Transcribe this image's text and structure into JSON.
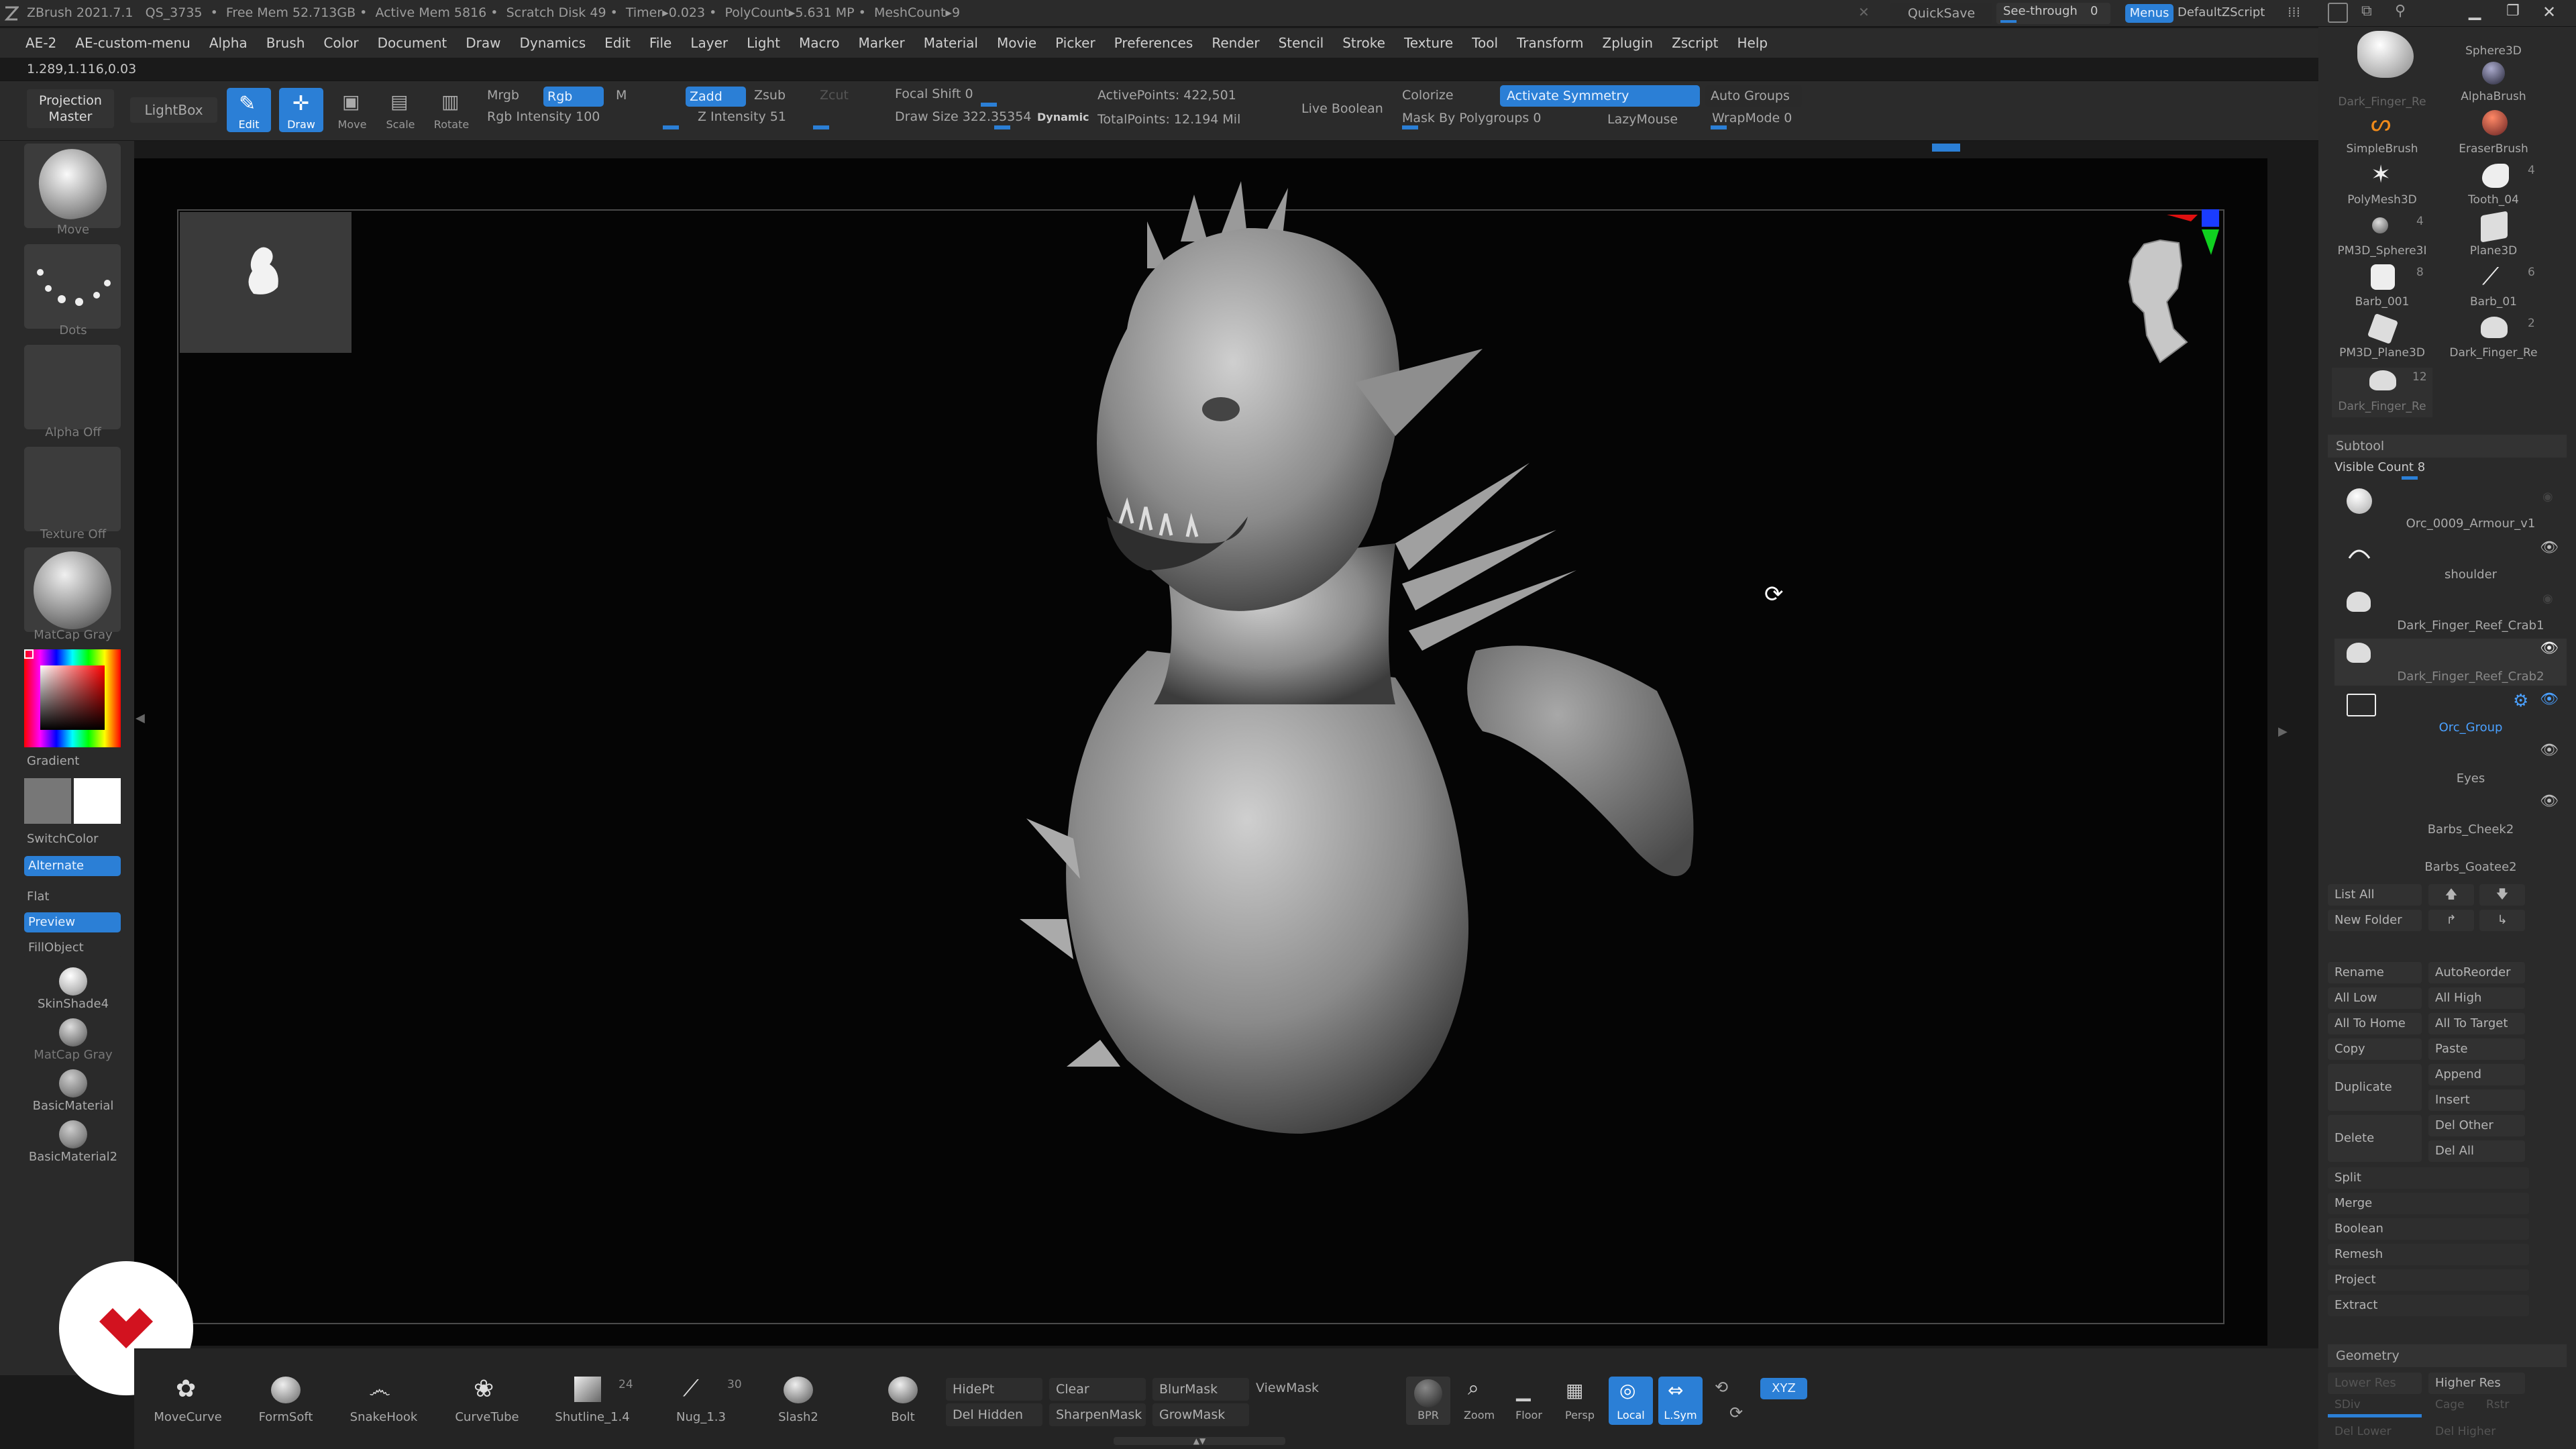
{
  "status_bar": {
    "app": "ZBrush 2021.7.1",
    "doc": "QS_3735",
    "free_mem": "Free Mem 52.713GB",
    "active_mem": "Active Mem 5816",
    "scratch": "Scratch Disk 49",
    "timer": "Timer▸0.023",
    "polycount": "PolyCount▸5.631 MP",
    "meshcount": "MeshCount▸9",
    "quicksave": "QuickSave",
    "see_through": "See-through",
    "see_through_value": "0",
    "menus": "Menus",
    "default_zscript": "DefaultZScript"
  },
  "menubar": [
    "AE-2",
    "AE-custom-menu",
    "Alpha",
    "Brush",
    "Color",
    "Document",
    "Draw",
    "Dynamics",
    "Edit",
    "File",
    "Layer",
    "Light",
    "Macro",
    "Marker",
    "Material",
    "Movie",
    "Picker",
    "Preferences",
    "Render",
    "Stencil",
    "Stroke",
    "Texture",
    "Tool",
    "Transform",
    "Zplugin",
    "Zscript",
    "Help"
  ],
  "coords": "1.289,1.116,0.03",
  "toolbar": {
    "projection_master": "Projection Master",
    "lightbox": "LightBox",
    "edit": "Edit",
    "draw": "Draw",
    "move": "Move",
    "scale": "Scale",
    "rotate": "Rotate",
    "mrgb": "Mrgb",
    "rgb": "Rgb",
    "m": "M",
    "rgb_intensity": "Rgb Intensity 100",
    "zadd": "Zadd",
    "zsub": "Zsub",
    "zcut": "Zcut",
    "z_intensity": "Z Intensity 51",
    "focal_shift": "Focal Shift 0",
    "draw_size": "Draw Size 322.35354",
    "dynamic": "Dynamic",
    "active_points": "ActivePoints: 422,501",
    "total_points": "TotalPoints: 12.194 Mil",
    "live_boolean": "Live Boolean",
    "colorize": "Colorize",
    "activate_symmetry": "Activate Symmetry",
    "mask_by_polygroups": "Mask By Polygroups 0",
    "lazymouse": "LazyMouse",
    "auto_groups": "Auto Groups",
    "wrapmode": "WrapMode 0"
  },
  "left_shelf": {
    "brush_label": "Move",
    "stroke_label": "Dots",
    "alpha_label": "Alpha Off",
    "texture_label": "Texture Off",
    "material_label": "MatCap Gray",
    "gradient": "Gradient",
    "switchcolor": "SwitchColor",
    "alternate": "Alternate",
    "flat": "Flat",
    "preview": "Preview",
    "fillobject": "FillObject",
    "materials": [
      "SkinShade4",
      "MatCap Gray",
      "BasicMaterial",
      "BasicMaterial2"
    ]
  },
  "tool_palette": [
    {
      "name": "Dark_Finger_Re",
      "count": ""
    },
    {
      "name": "Sphere3D",
      "count": ""
    },
    {
      "name": "AlphaBrush",
      "count": ""
    },
    {
      "name": "SimpleBrush",
      "count": ""
    },
    {
      "name": "EraserBrush",
      "count": ""
    },
    {
      "name": "PolyMesh3D",
      "count": ""
    },
    {
      "name": "Tooth_04",
      "count": "4"
    },
    {
      "name": "PM3D_Sphere3I",
      "count": "4"
    },
    {
      "name": "Plane3D",
      "count": ""
    },
    {
      "name": "Barb_001",
      "count": "8"
    },
    {
      "name": "Barb_01",
      "count": "6"
    },
    {
      "name": "PM3D_Plane3D",
      "count": ""
    },
    {
      "name": "Dark_Finger_Re",
      "count": "2"
    },
    {
      "name": "Dark_Finger_Re",
      "count": "12"
    }
  ],
  "subtool": {
    "header": "Subtool",
    "visible_count": "Visible Count 8",
    "items": [
      "Orc_0009_Armour_v1",
      "shoulder",
      "Dark_Finger_Reef_Crab1",
      "Dark_Finger_Reef_Crab2",
      "Orc_Group",
      "Eyes",
      "Barbs_Cheek2",
      "Barbs_Goatee2"
    ],
    "list_all": "List All",
    "new_folder": "New Folder",
    "rename": "Rename",
    "autoreorder": "AutoReorder",
    "all_low": "All Low",
    "all_high": "All High",
    "all_to_home": "All To Home",
    "all_to_target": "All To Target",
    "copy": "Copy",
    "paste": "Paste",
    "duplicate": "Duplicate",
    "append": "Append",
    "insert": "Insert",
    "delete": "Delete",
    "del_other": "Del Other",
    "del_all": "Del All",
    "split": "Split",
    "merge": "Merge",
    "boolean": "Boolean",
    "remesh": "Remesh",
    "project": "Project",
    "extract": "Extract"
  },
  "geometry": {
    "header": "Geometry",
    "lower_res": "Lower Res",
    "higher_res": "Higher Res",
    "sdiv": "SDiv",
    "cage": "Cage",
    "rstr": "Rstr",
    "del_lower": "Del Lower",
    "del_higher": "Del Higher"
  },
  "bottom_shelf": {
    "brushes": [
      {
        "name": "MoveCurve",
        "count": ""
      },
      {
        "name": "FormSoft",
        "count": ""
      },
      {
        "name": "SnakeHook",
        "count": ""
      },
      {
        "name": "CurveTube",
        "count": ""
      },
      {
        "name": "Shutline_1.4",
        "count": "24"
      },
      {
        "name": "Nug_1.3",
        "count": "30"
      },
      {
        "name": "Slash2",
        "count": ""
      },
      {
        "name": "Bolt",
        "count": ""
      }
    ],
    "hidept": "HidePt",
    "del_hidden": "Del Hidden",
    "clear": "Clear",
    "sharpenmask": "SharpenMask",
    "blurmask": "BlurMask",
    "growmask": "GrowMask",
    "viewmask": "ViewMask",
    "bpr": "BPR",
    "zoom": "Zoom",
    "floor": "Floor",
    "persp": "Persp",
    "local": "Local",
    "lsym": "L.Sym",
    "xyz": "XYZ"
  },
  "colors": {
    "accent_blue": "#2b7fd6",
    "panel": "#2a2a2a",
    "viewport": "#050505",
    "logo_red": "#d2121f"
  }
}
